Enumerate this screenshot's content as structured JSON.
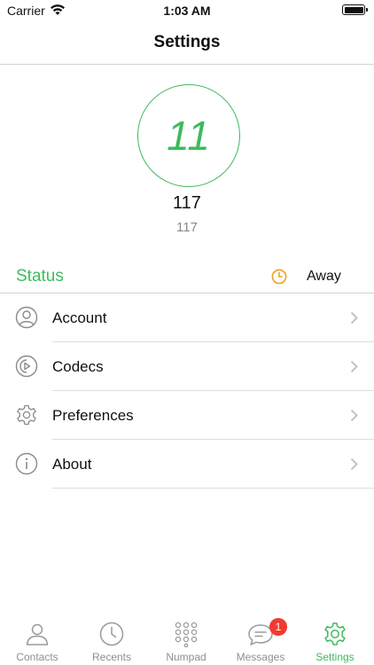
{
  "status_bar": {
    "carrier": "Carrier",
    "time": "1:03 AM"
  },
  "nav": {
    "title": "Settings"
  },
  "profile": {
    "avatar_text": "11",
    "name": "117",
    "extension": "117",
    "accent_color": "#3dbb5c"
  },
  "status": {
    "label": "Status",
    "value": "Away",
    "icon": "clock-icon",
    "icon_color": "#f0a020"
  },
  "menu": {
    "items": [
      {
        "label": "Account",
        "icon": "user-icon"
      },
      {
        "label": "Codecs",
        "icon": "codecs-icon"
      },
      {
        "label": "Preferences",
        "icon": "gear-icon"
      },
      {
        "label": "About",
        "icon": "info-icon"
      }
    ]
  },
  "tabs": [
    {
      "label": "Contacts",
      "icon": "contacts-icon",
      "active": false
    },
    {
      "label": "Recents",
      "icon": "clock-icon",
      "active": false
    },
    {
      "label": "Numpad",
      "icon": "numpad-icon",
      "active": false
    },
    {
      "label": "Messages",
      "icon": "messages-icon",
      "active": false,
      "badge": "1"
    },
    {
      "label": "Settings",
      "icon": "gear-icon",
      "active": true
    }
  ]
}
